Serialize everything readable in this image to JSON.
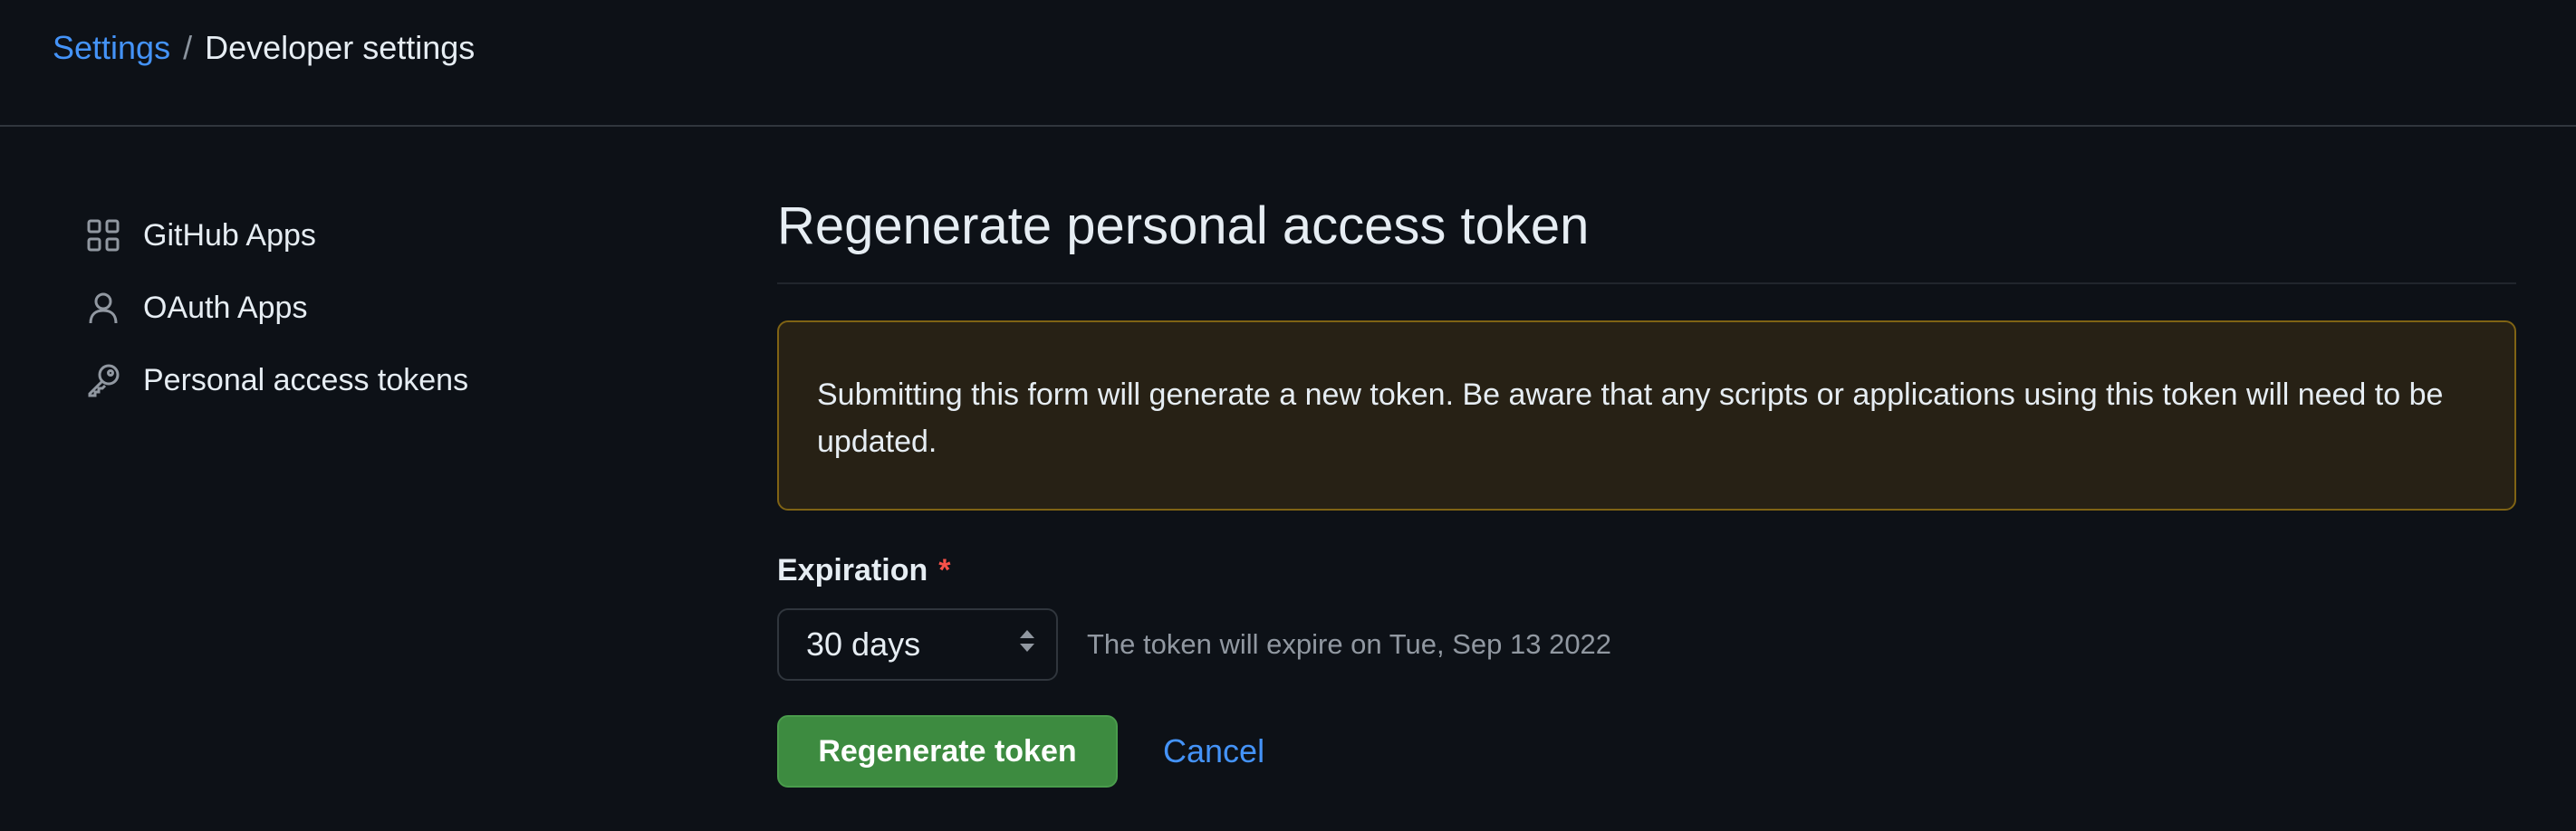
{
  "breadcrumb": {
    "root": "Settings",
    "separator": "/",
    "current": "Developer settings"
  },
  "sidebar": {
    "items": [
      {
        "label": "GitHub Apps",
        "icon": "apps-grid-icon"
      },
      {
        "label": "OAuth Apps",
        "icon": "person-icon"
      },
      {
        "label": "Personal access tokens",
        "icon": "key-icon"
      }
    ]
  },
  "main": {
    "title": "Regenerate personal access token",
    "warning": "Submitting this form will generate a new token. Be aware that any scripts or applications using this token will need to be updated.",
    "expiration": {
      "label": "Expiration",
      "required_marker": "*",
      "selected": "30 days",
      "note": "The token will expire on Tue, Sep 13 2022"
    },
    "actions": {
      "submit": "Regenerate token",
      "cancel": "Cancel"
    }
  },
  "colors": {
    "background": "#0d1117",
    "link": "#4493f8",
    "primary_button": "#3d8b40",
    "warning_background": "#272115",
    "warning_border": "#7f6314",
    "required": "#f85149"
  }
}
